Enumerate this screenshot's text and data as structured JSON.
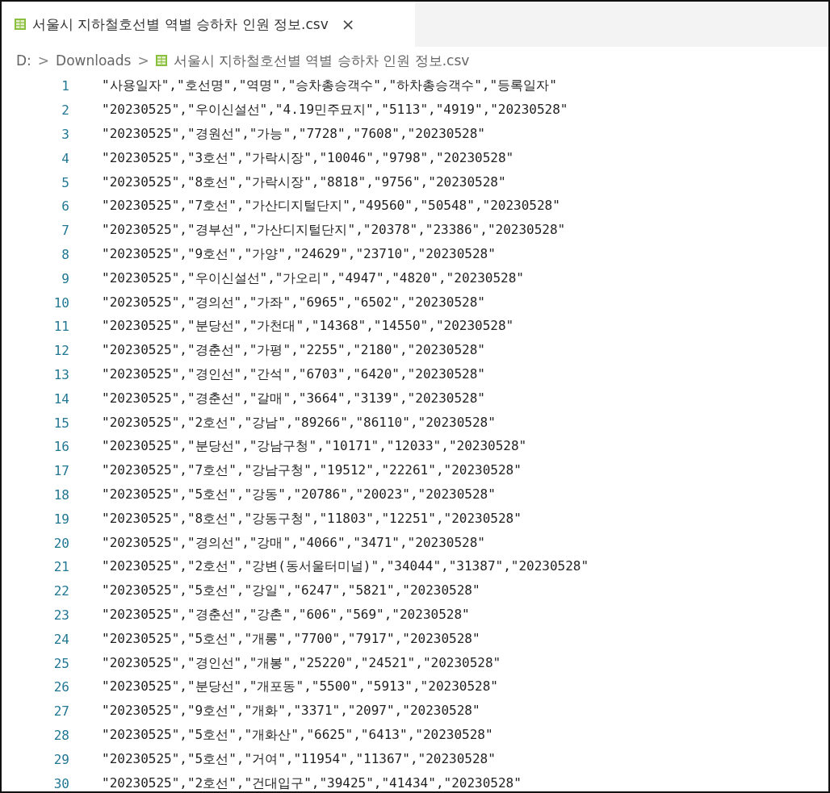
{
  "tab": {
    "title": "서울시 지하철호선별 역별 승하차 인원 정보.csv",
    "close": "×",
    "selected": true
  },
  "breadcrumb": [
    {
      "kind": "segment",
      "text": "D:"
    },
    {
      "kind": "separator",
      "text": ">"
    },
    {
      "kind": "segment",
      "text": "Downloads"
    },
    {
      "kind": "separator",
      "text": ">"
    },
    {
      "kind": "file",
      "text": "서울시 지하철호선별 역별 승하차 인원 정보.csv"
    }
  ],
  "editor": {
    "lines": [
      {
        "number": "1",
        "text": "\"사용일자\",\"호선명\",\"역명\",\"승차총승객수\",\"하차총승객수\",\"등록일자\""
      },
      {
        "number": "2",
        "text": "\"20230525\",\"우이신설선\",\"4.19민주묘지\",\"5113\",\"4919\",\"20230528\""
      },
      {
        "number": "3",
        "text": "\"20230525\",\"경원선\",\"가능\",\"7728\",\"7608\",\"20230528\""
      },
      {
        "number": "4",
        "text": "\"20230525\",\"3호선\",\"가락시장\",\"10046\",\"9798\",\"20230528\""
      },
      {
        "number": "5",
        "text": "\"20230525\",\"8호선\",\"가락시장\",\"8818\",\"9756\",\"20230528\""
      },
      {
        "number": "6",
        "text": "\"20230525\",\"7호선\",\"가산디지털단지\",\"49560\",\"50548\",\"20230528\""
      },
      {
        "number": "7",
        "text": "\"20230525\",\"경부선\",\"가산디지털단지\",\"20378\",\"23386\",\"20230528\""
      },
      {
        "number": "8",
        "text": "\"20230525\",\"9호선\",\"가양\",\"24629\",\"23710\",\"20230528\""
      },
      {
        "number": "9",
        "text": "\"20230525\",\"우이신설선\",\"가오리\",\"4947\",\"4820\",\"20230528\""
      },
      {
        "number": "10",
        "text": "\"20230525\",\"경의선\",\"가좌\",\"6965\",\"6502\",\"20230528\""
      },
      {
        "number": "11",
        "text": "\"20230525\",\"분당선\",\"가천대\",\"14368\",\"14550\",\"20230528\""
      },
      {
        "number": "12",
        "text": "\"20230525\",\"경춘선\",\"가평\",\"2255\",\"2180\",\"20230528\""
      },
      {
        "number": "13",
        "text": "\"20230525\",\"경인선\",\"간석\",\"6703\",\"6420\",\"20230528\""
      },
      {
        "number": "14",
        "text": "\"20230525\",\"경춘선\",\"갈매\",\"3664\",\"3139\",\"20230528\""
      },
      {
        "number": "15",
        "text": "\"20230525\",\"2호선\",\"강남\",\"89266\",\"86110\",\"20230528\""
      },
      {
        "number": "16",
        "text": "\"20230525\",\"분당선\",\"강남구청\",\"10171\",\"12033\",\"20230528\""
      },
      {
        "number": "17",
        "text": "\"20230525\",\"7호선\",\"강남구청\",\"19512\",\"22261\",\"20230528\""
      },
      {
        "number": "18",
        "text": "\"20230525\",\"5호선\",\"강동\",\"20786\",\"20023\",\"20230528\""
      },
      {
        "number": "19",
        "text": "\"20230525\",\"8호선\",\"강동구청\",\"11803\",\"12251\",\"20230528\""
      },
      {
        "number": "20",
        "text": "\"20230525\",\"경의선\",\"강매\",\"4066\",\"3471\",\"20230528\""
      },
      {
        "number": "21",
        "text": "\"20230525\",\"2호선\",\"강변(동서울터미널)\",\"34044\",\"31387\",\"20230528\""
      },
      {
        "number": "22",
        "text": "\"20230525\",\"5호선\",\"강일\",\"6247\",\"5821\",\"20230528\""
      },
      {
        "number": "23",
        "text": "\"20230525\",\"경춘선\",\"강촌\",\"606\",\"569\",\"20230528\""
      },
      {
        "number": "24",
        "text": "\"20230525\",\"5호선\",\"개롱\",\"7700\",\"7917\",\"20230528\""
      },
      {
        "number": "25",
        "text": "\"20230525\",\"경인선\",\"개봉\",\"25220\",\"24521\",\"20230528\""
      },
      {
        "number": "26",
        "text": "\"20230525\",\"분당선\",\"개포동\",\"5500\",\"5913\",\"20230528\""
      },
      {
        "number": "27",
        "text": "\"20230525\",\"9호선\",\"개화\",\"3371\",\"2097\",\"20230528\""
      },
      {
        "number": "28",
        "text": "\"20230525\",\"5호선\",\"개화산\",\"6625\",\"6413\",\"20230528\""
      },
      {
        "number": "29",
        "text": "\"20230525\",\"5호선\",\"거여\",\"11954\",\"11367\",\"20230528\""
      },
      {
        "number": "30",
        "text": "\"20230525\",\"2호선\",\"건대입구\",\"39425\",\"41434\",\"20230528\""
      }
    ]
  }
}
